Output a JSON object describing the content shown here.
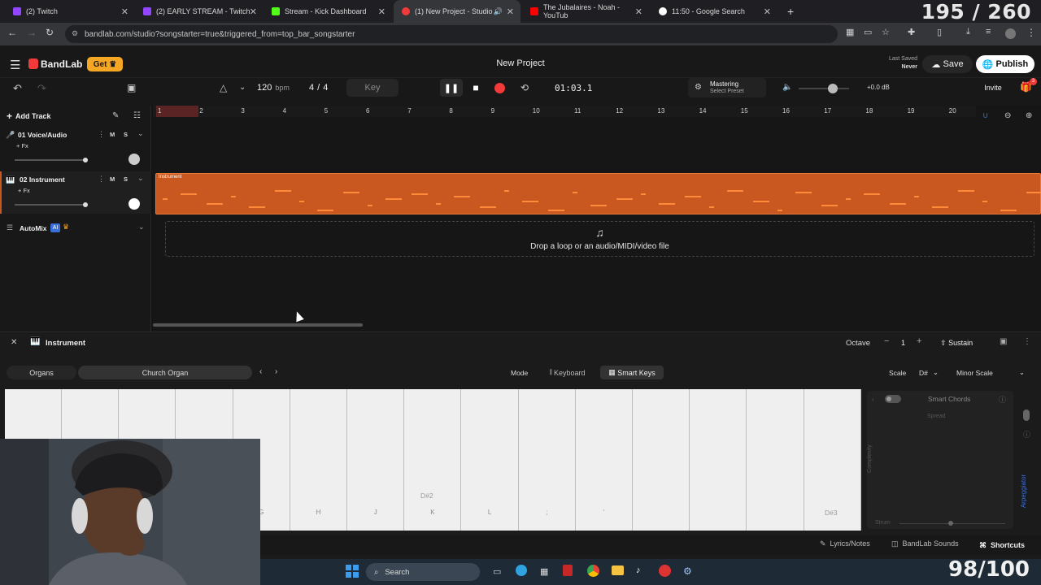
{
  "browser": {
    "tabs": [
      {
        "label": "(2) Twitch",
        "color": "#9146ff"
      },
      {
        "label": "(2) EARLY STREAM - Twitch",
        "color": "#9146ff"
      },
      {
        "label": "Stream - Kick Dashboard",
        "color": "#53fc18"
      },
      {
        "label": "(1) New Project - Studio",
        "color": "#f23a3a"
      },
      {
        "label": "The Jubalaires - Noah - YouTub",
        "color": "#ff0000"
      },
      {
        "label": "11:50 - Google Search",
        "color": "#ffffff"
      }
    ],
    "url": "bandlab.com/studio?songstarter=true&triggered_from=top_bar_songstarter"
  },
  "overlay": {
    "counter_top": "195 / 260",
    "counter_bottom": "98/100"
  },
  "header": {
    "brand": "BandLab",
    "get_label": "Get",
    "project_title": "New Project",
    "last_saved_label": "Last Saved",
    "last_saved_value": "Never",
    "save_label": "Save",
    "publish_label": "Publish"
  },
  "toolbar": {
    "bpm_value": "120",
    "bpm_unit": "bpm",
    "time_sig_num": "4",
    "time_sig_sep": "/",
    "time_sig_den": "4",
    "key_label": "Key",
    "time_display": "01:03.1",
    "mastering_label": "Mastering",
    "mastering_preset": "Select Preset",
    "volume_db": "+0.0 dB",
    "invite_label": "Invite",
    "gift_badge": "3"
  },
  "tracks": {
    "add_track_label": "Add Track",
    "items": [
      {
        "name": "01  Voice/Audio",
        "fx": "+ Fx",
        "m": "M",
        "s": "S"
      },
      {
        "name": "02  Instrument",
        "fx": "+ Fx",
        "m": "M",
        "s": "S"
      }
    ],
    "automix_label": "AutoMix",
    "automix_badge": "AI",
    "region_label": "Instrument",
    "drop_text": "Drop a loop or an audio/MIDI/video file"
  },
  "ruler": [
    "1",
    "2",
    "3",
    "4",
    "5",
    "6",
    "7",
    "8",
    "9",
    "10",
    "11",
    "12",
    "13",
    "14",
    "15",
    "16",
    "17",
    "18",
    "19",
    "20"
  ],
  "instrument_panel": {
    "title": "Instrument",
    "octave_label": "Octave",
    "octave_value": "1",
    "sustain_label": "Sustain",
    "category": "Organs",
    "preset": "Church Organ",
    "mode_label": "Mode",
    "keyboard_label": "Keyboard",
    "smart_keys_label": "Smart Keys",
    "scale_label": "Scale",
    "scale_key": "D#",
    "scale_type": "Minor Scale",
    "key_labels": [
      "",
      "",
      "",
      "",
      "G",
      "H",
      "J",
      "K",
      "L",
      ";",
      "'",
      "",
      "",
      "",
      ""
    ],
    "note_labels": {
      "d2": "D#2",
      "d3": "D#3"
    },
    "smart_chords_label": "Smart Chords",
    "spread_label": "Spread",
    "complexity_label": "Complexity",
    "strum_label": "Strum",
    "arpeggiator_label": "Arpeggiator"
  },
  "bottom_bar": {
    "lyrics_label": "Lyrics/Notes",
    "sounds_label": "BandLab Sounds",
    "shortcuts_label": "Shortcuts"
  },
  "taskbar": {
    "search_label": "Search"
  },
  "colors": {
    "accent": "#f23a3a",
    "region": "#c8581f",
    "get_badge": "#f5a623"
  }
}
